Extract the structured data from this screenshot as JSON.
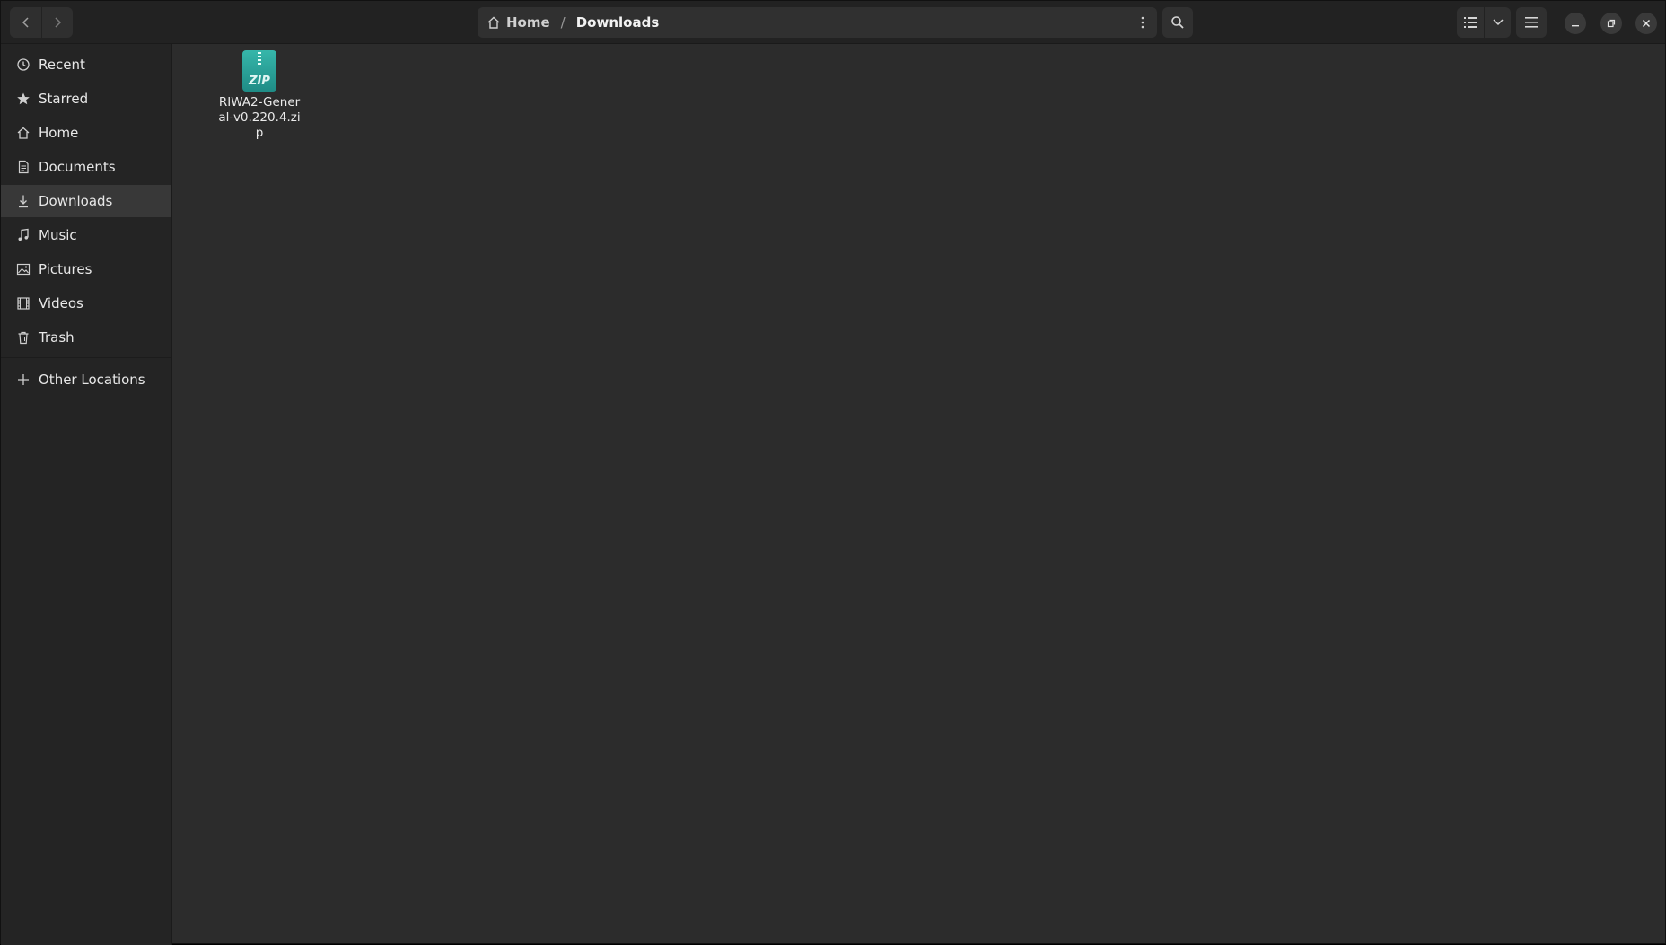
{
  "header": {
    "breadcrumb": [
      {
        "label": "Home",
        "icon": "home-icon"
      },
      {
        "label": "Downloads"
      }
    ]
  },
  "sidebar": {
    "items": [
      {
        "label": "Recent",
        "icon": "clock-icon"
      },
      {
        "label": "Starred",
        "icon": "star-icon"
      },
      {
        "label": "Home",
        "icon": "home-icon"
      },
      {
        "label": "Documents",
        "icon": "document-icon"
      },
      {
        "label": "Downloads",
        "icon": "download-icon",
        "active": true
      },
      {
        "label": "Music",
        "icon": "music-icon"
      },
      {
        "label": "Pictures",
        "icon": "picture-icon"
      },
      {
        "label": "Videos",
        "icon": "video-icon"
      },
      {
        "label": "Trash",
        "icon": "trash-icon"
      }
    ],
    "other_locations": {
      "label": "Other Locations",
      "icon": "plus-icon"
    }
  },
  "files": [
    {
      "name": "RIWA2-General-v0.220.4.zip",
      "icon": "zip-archive-icon",
      "badge": "ZIP"
    }
  ],
  "colors": {
    "window_bg": "#2c2c2c",
    "sidebar_bg": "#242424",
    "header_bg": "#222222",
    "active_item": "#383838",
    "zip_icon": "#2aa39a"
  }
}
